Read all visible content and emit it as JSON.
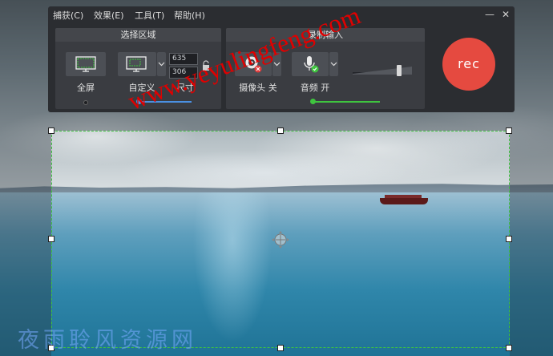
{
  "menu": {
    "capture": "捕获(C)",
    "effects": "效果(E)",
    "tools": "工具(T)",
    "help": "帮助(H)"
  },
  "window_controls": {
    "minimize_icon": "minimize-icon",
    "close_icon": "close-icon"
  },
  "select_area": {
    "title": "选择区域",
    "fullscreen_label": "全屏",
    "custom_label": "自定义",
    "size_label": "尺寸",
    "width": "635",
    "height": "306"
  },
  "record_input": {
    "title": "录制输入",
    "camera_label": "摄像头 关",
    "audio_label": "音频 开",
    "volume_level": 0.82
  },
  "rec_button": {
    "label": "rec"
  },
  "watermarks": {
    "url": "www.yeyulingfeng.com",
    "site_cn": "夜雨聆风资源网"
  },
  "colors": {
    "accent_green": "#3fc43f",
    "accent_blue": "#4a90e2",
    "rec_red": "#e54a40",
    "toolbar_bg": "#2b2d31"
  }
}
